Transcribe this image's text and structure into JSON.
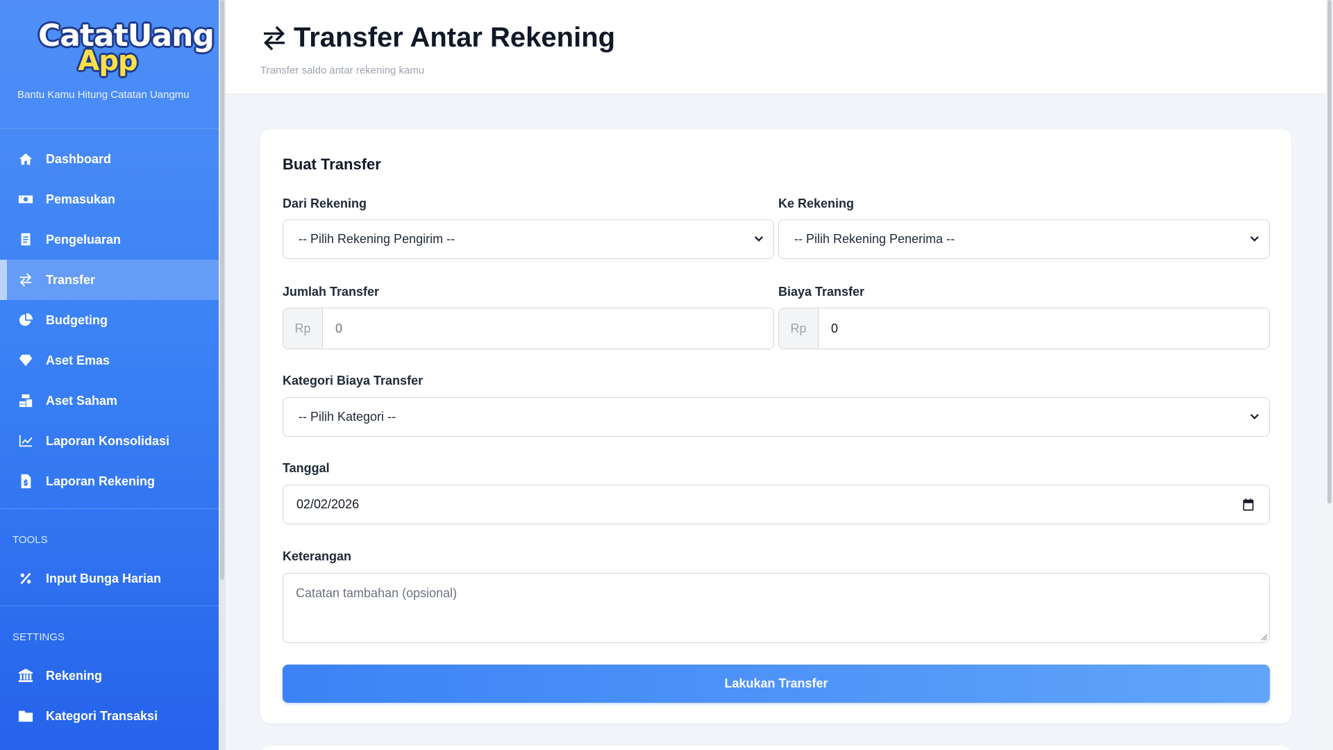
{
  "brand": {
    "logo_line1": "CatatUang",
    "logo_line2": "App",
    "tagline": "Bantu Kamu Hitung Catatan Uangmu"
  },
  "nav": {
    "main": [
      {
        "label": "Dashboard",
        "icon": "home-icon"
      },
      {
        "label": "Pemasukan",
        "icon": "money-bill-icon"
      },
      {
        "label": "Pengeluaran",
        "icon": "receipt-icon"
      },
      {
        "label": "Transfer",
        "icon": "exchange-icon",
        "active": true
      },
      {
        "label": "Budgeting",
        "icon": "pie-chart-icon"
      },
      {
        "label": "Aset Emas",
        "icon": "gem-icon"
      },
      {
        "label": "Aset Saham",
        "icon": "coins-stack-icon"
      },
      {
        "label": "Laporan Konsolidasi",
        "icon": "line-chart-icon"
      },
      {
        "label": "Laporan Rekening",
        "icon": "invoice-icon"
      }
    ],
    "tools_title": "TOOLS",
    "tools": [
      {
        "label": "Input Bunga Harian",
        "icon": "percent-icon"
      }
    ],
    "settings_title": "SETTINGS",
    "settings": [
      {
        "label": "Rekening",
        "icon": "bank-icon"
      },
      {
        "label": "Kategori Transaksi",
        "icon": "folder-icon"
      }
    ]
  },
  "header": {
    "title": "Transfer Antar Rekening",
    "subtitle": "Transfer saldo antar rekening kamu"
  },
  "form": {
    "title": "Buat Transfer",
    "from_label": "Dari Rekening",
    "from_value": "-- Pilih Rekening Pengirim --",
    "to_label": "Ke Rekening",
    "to_value": "-- Pilih Rekening Penerima --",
    "amount_label": "Jumlah Transfer",
    "amount_prefix": "Rp",
    "amount_placeholder": "0",
    "fee_label": "Biaya Transfer",
    "fee_prefix": "Rp",
    "fee_value": "0",
    "fee_category_label": "Kategori Biaya Transfer",
    "fee_category_value": "-- Pilih Kategori --",
    "date_label": "Tanggal",
    "date_value": "02/02/2026",
    "note_label": "Keterangan",
    "note_placeholder": "Catatan tambahan (opsional)",
    "submit_label": "Lakukan Transfer"
  },
  "colors": {
    "sidebar_top": "#4f8ff7",
    "sidebar_bottom": "#2563eb",
    "accent": "#3b82f6",
    "background": "#f1f5f9"
  }
}
